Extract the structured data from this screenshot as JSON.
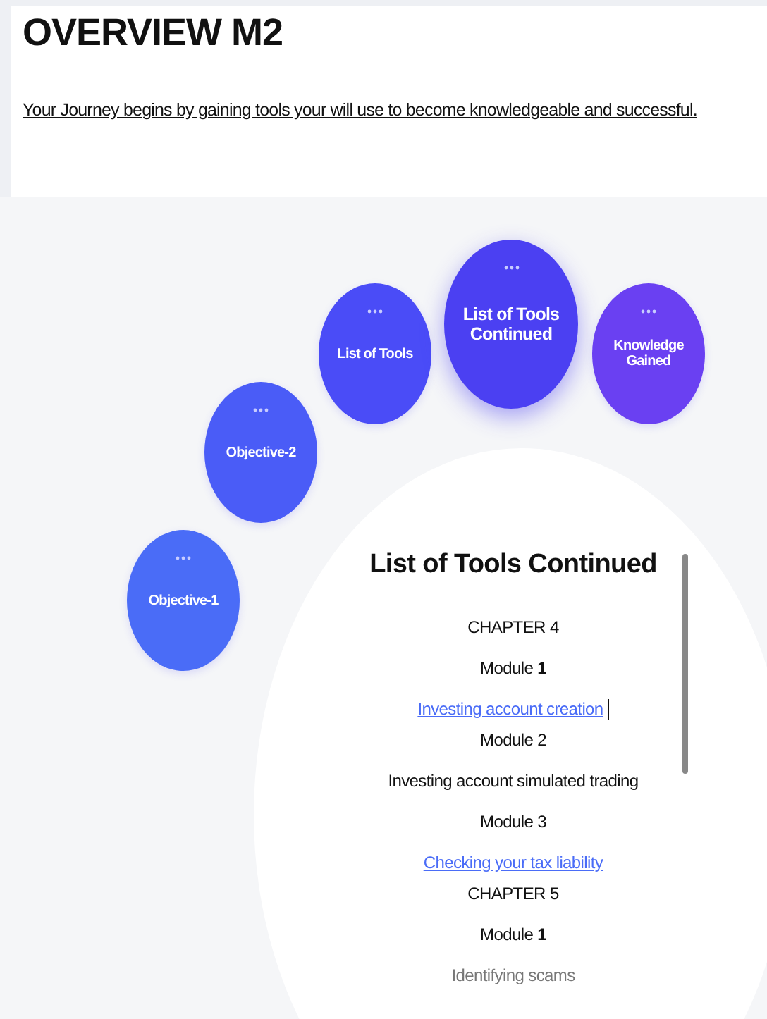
{
  "header": {
    "title": "OVERVIEW M2",
    "subtitle": "Your Journey begins by gaining tools your will use to become knowledgeable and successful."
  },
  "steps": [
    {
      "label": "Objective-1",
      "selected": false,
      "color": "#4a6cf7"
    },
    {
      "label": "Objective-2",
      "selected": false,
      "color": "#4a5cf7"
    },
    {
      "label": "List of Tools",
      "selected": false,
      "color": "#4a4cf7"
    },
    {
      "label": "List of Tools Continued",
      "selected": true,
      "color": "#4b40f2"
    },
    {
      "label": "Knowledge Gained",
      "selected": false,
      "color": "#6a40f2"
    }
  ],
  "panel": {
    "title": "List of Tools Continued",
    "lines": [
      {
        "kind": "heading",
        "text": "CHAPTER 4"
      },
      {
        "kind": "module",
        "text": "Module **1**"
      },
      {
        "kind": "link",
        "text": "Investing account creation",
        "cursor": true
      },
      {
        "kind": "module",
        "text": "Module 2"
      },
      {
        "kind": "text",
        "text": "Investing account simulated trading"
      },
      {
        "kind": "module",
        "text": "Module 3"
      },
      {
        "kind": "link",
        "text": "Checking your tax liability",
        "cursor": false
      },
      {
        "kind": "heading",
        "text": "CHAPTER 5"
      },
      {
        "kind": "module",
        "text": "Module **1**"
      },
      {
        "kind": "faded",
        "text": "Identifying scams"
      }
    ]
  }
}
